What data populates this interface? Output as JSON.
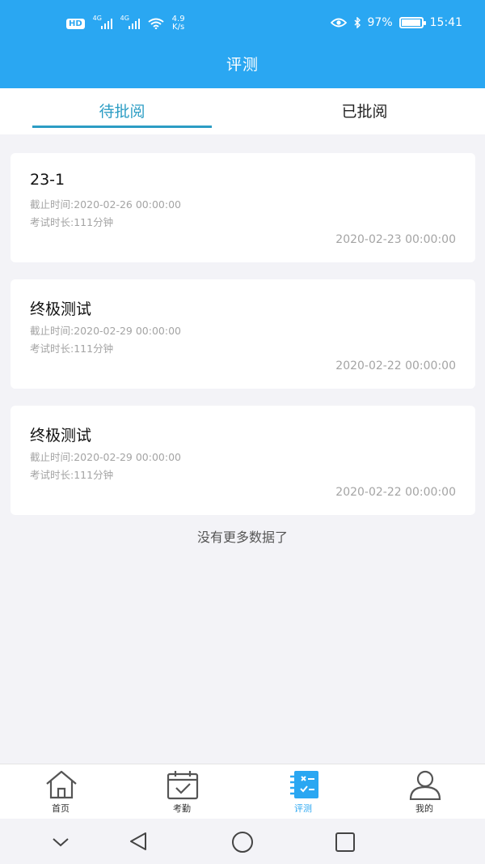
{
  "status_bar": {
    "hd": "HD",
    "net1": "4G",
    "net2": "4G",
    "speed_value": "4.9",
    "speed_unit": "K/s",
    "battery": "97%",
    "time": "15:41"
  },
  "header": {
    "title": "评测"
  },
  "tabs": [
    {
      "label": "待批阅",
      "active": true
    },
    {
      "label": "已批阅",
      "active": false
    }
  ],
  "exams": [
    {
      "title": "23-1",
      "deadline": "截止时间:2020-02-26 00:00:00",
      "duration": "考试时长:111分钟",
      "date": "2020-02-23 00:00:00"
    },
    {
      "title": "终极测试",
      "deadline": "截止时间:2020-02-29 00:00:00",
      "duration": "考试时长:111分钟",
      "date": "2020-02-22 00:00:00"
    },
    {
      "title": "终极测试",
      "deadline": "截止时间:2020-02-29 00:00:00",
      "duration": "考试时长:111分钟",
      "date": "2020-02-22 00:00:00"
    }
  ],
  "list_end_text": "没有更多数据了",
  "bottom_nav": [
    {
      "label": "首页",
      "icon": "home-icon"
    },
    {
      "label": "考勤",
      "icon": "calendar-check-icon"
    },
    {
      "label": "评测",
      "icon": "checklist-notebook-icon",
      "active": true
    },
    {
      "label": "我的",
      "icon": "user-icon"
    }
  ],
  "colors": {
    "primary": "#2aa7f2",
    "tab_active": "#2c9dc4",
    "background": "#f3f3f7"
  }
}
